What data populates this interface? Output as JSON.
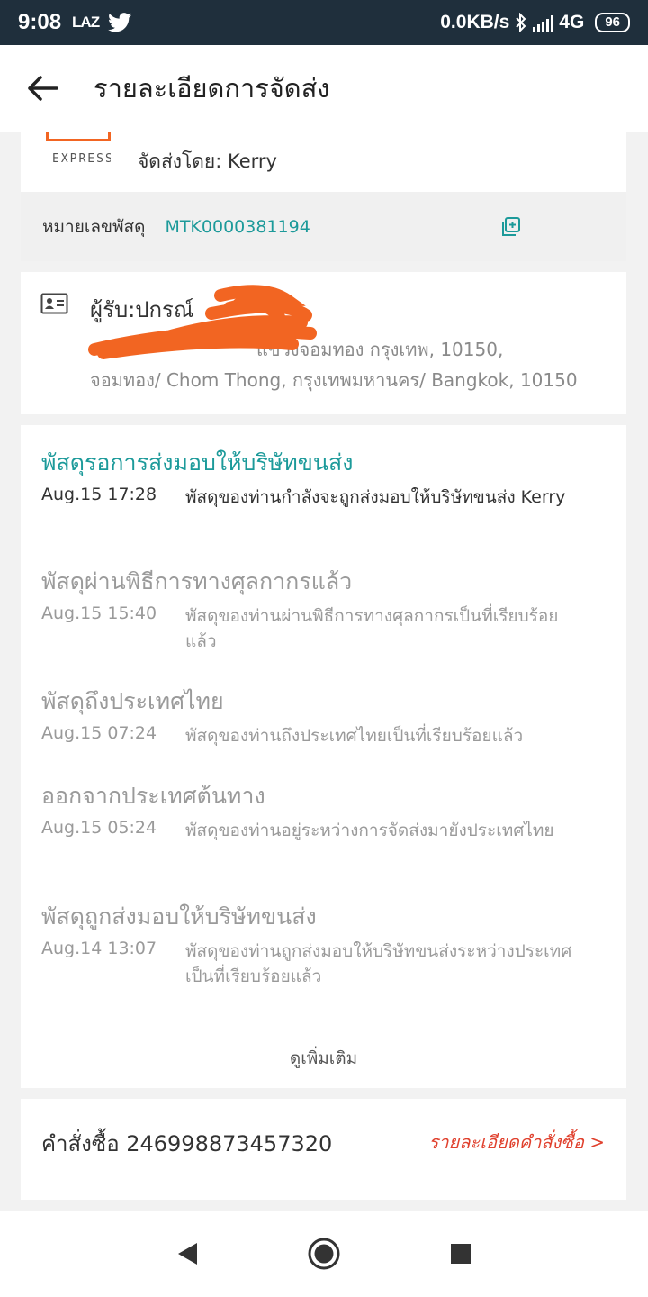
{
  "status_bar": {
    "time": "9:08",
    "app_icon_text": "LAZ",
    "net_speed": "0.0KB/s",
    "network": "4G",
    "battery": "96"
  },
  "app_bar": {
    "title": "รายละเอียดการจัดส่ง"
  },
  "carrier": {
    "logo_text": "EXPRESS",
    "shipped_by": "จัดส่งโดย: Kerry",
    "tracking_label": "หมายเลขพัสดุ",
    "tracking_number": "MTK0000381194"
  },
  "recipient": {
    "name": "ผู้รับ:ปกรณ์",
    "address_line1": "แขวงจอมทอง  กรุงเทพ, 10150,",
    "address_line2": "จอมทอง/ Chom Thong, กรุงเทพมหานคร/ Bangkok, 10150"
  },
  "tracking_events": [
    {
      "title": "พัสดุรอการส่งมอบให้บริษัทขนส่ง",
      "time": "Aug.15 17:28",
      "desc": "พัสดุของท่านกำลังจะถูกส่งมอบให้บริษัทขนส่ง Kerry"
    },
    {
      "title": "พัสดุผ่านพิธีการทางศุลกากรแล้ว",
      "time": "Aug.15 15:40",
      "desc": "พัสดุของท่านผ่านพิธีการทางศุลกากรเป็นที่เรียบร้อยแล้ว"
    },
    {
      "title": "พัสดุถึงประเทศไทย",
      "time": "Aug.15 07:24",
      "desc": "พัสดุของท่านถึงประเทศไทยเป็นที่เรียบร้อยแล้ว"
    },
    {
      "title": "ออกจากประเทศต้นทาง",
      "time": "Aug.15 05:24",
      "desc": "พัสดุของท่านอยู่ระหว่างการจัดส่งมายังประเทศไทย"
    },
    {
      "title": "พัสดุถูกส่งมอบให้บริษัทขนส่ง",
      "time": "Aug.14 13:07",
      "desc": "พัสดุของท่านถูกส่งมอบให้บริษัทขนส่งระหว่างประเทศเป็นที่เรียบร้อยแล้ว"
    }
  ],
  "see_more": "ดูเพิ่มเติม",
  "order": {
    "label": "คำสั่งซื้อ 246998873457320",
    "details_link": "รายละเอียดคำสั่งซื้อ >"
  },
  "colors": {
    "accent": "#1c9a9a",
    "link": "#e0412e",
    "status_bar": "#1f2f3c",
    "redaction": "#f26522"
  }
}
